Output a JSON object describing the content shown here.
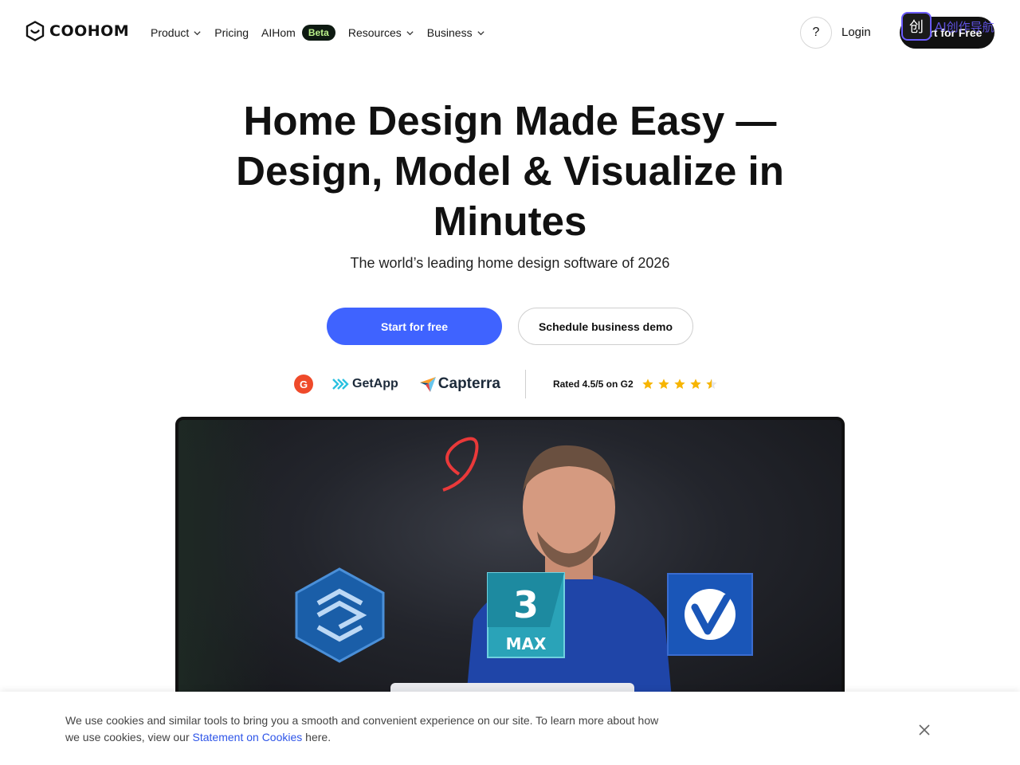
{
  "header": {
    "logo_text": "COOHOM",
    "nav": [
      {
        "label": "Product",
        "has_dropdown": true
      },
      {
        "label": "Pricing",
        "has_dropdown": false
      },
      {
        "label": "AIHom",
        "badge": "Beta"
      },
      {
        "label": "Resources",
        "has_dropdown": true
      },
      {
        "label": "Business",
        "has_dropdown": true
      }
    ],
    "help_label": "?",
    "login_label": "Login",
    "start_free_label": "Start for Free",
    "overlay_icon_glyph": "创",
    "overlay_text": "AI创作导航"
  },
  "hero": {
    "title_line1": "Home Design Made Easy —",
    "title_line2": "Design, Model & Visualize in",
    "title_line3": "Minutes",
    "subtitle": "The world’s leading home design software of 2026",
    "primary_cta": "Start for free",
    "secondary_cta": "Schedule business demo"
  },
  "ratings": {
    "g2_letter": "G",
    "getapp_label": "GetApp",
    "capterra_label": "Capterra",
    "rated_text": "Rated 4.5/5 on G2",
    "rating_value": 4.5,
    "rating_max": 5
  },
  "video": {
    "max_number": "3",
    "max_label": "MAX"
  },
  "cookie": {
    "text_before": "We use cookies and similar tools to bring you a smooth and convenient experience on our site. To learn more about how we use cookies, view our ",
    "link_text": "Statement on Cookies",
    "text_after": " here."
  },
  "colors": {
    "primary": "#3f63ff",
    "beta_bg": "#0e1a12",
    "beta_text": "#b9f08a",
    "star": "#f7b500",
    "link": "#2e55e8"
  }
}
